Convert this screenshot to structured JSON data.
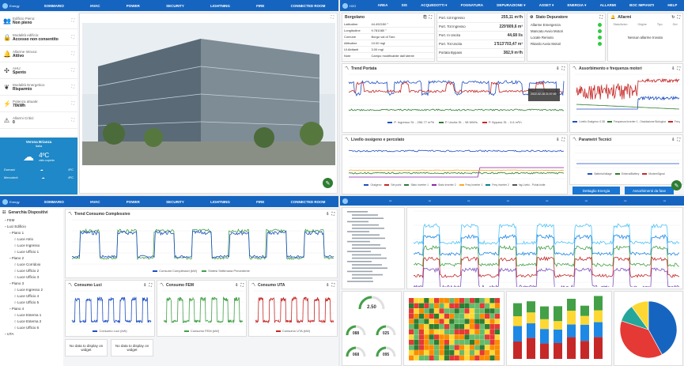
{
  "quad1": {
    "nav": [
      "SOMMARIO",
      "HVAC",
      "POWER",
      "SECURITY",
      "LIGHTNING",
      "FIRE",
      "CONNECTED ROOM"
    ],
    "status": [
      {
        "label": "Edificio Pieno:",
        "value": "Non pieno",
        "icon": "users-icon"
      },
      {
        "label": "Modalità edificio:",
        "value": "Accesso non consentito",
        "icon": "lock-icon"
      },
      {
        "label": "Allarme Intruso:",
        "value": "Attivo",
        "icon": "bell-icon"
      },
      {
        "label": "AHU:",
        "value": "Spento",
        "icon": "fan-icon"
      },
      {
        "label": "Modalità Energetica:",
        "value": "Risparmio",
        "icon": "leaf-icon"
      },
      {
        "label": "Potenza attuale:",
        "value": "70kWh",
        "icon": "bolt-icon"
      },
      {
        "label": "Allarmi Critici:",
        "value": "0",
        "icon": "alarm-icon"
      }
    ],
    "weather": {
      "city": "Verona Brianza",
      "region": "Italia",
      "temp": "4ºC",
      "desc": "cielo coperto",
      "row1_label": "Domani",
      "row2_label": "Mercoledì",
      "row1_temp": "6ºC",
      "row2_temp": "8ºC"
    }
  },
  "quad2": {
    "nav": [
      "AREA",
      "SIS",
      "ACQUEDOTTI ▾",
      "FOGNATURA",
      "DEPURAZIONE ▾",
      "ASSET ▾",
      "ENERGIA ▾",
      "ALLARMI",
      "BOC IMPIANTI",
      "HELP"
    ],
    "site": {
      "name": "Borgolano",
      "rows": [
        [
          "Latitudine",
          "44.492150 °"
        ],
        [
          "Longitudine",
          "9.781080 °"
        ],
        [
          "Comune",
          "Borgo val di Taro"
        ],
        [
          "Altitudine",
          "10.00 mgl"
        ],
        [
          "Ul.Abitanti",
          "3.00 mgl"
        ],
        [
          "Note",
          "Campo modificabile dall'utente"
        ]
      ]
    },
    "ports": [
      [
        "Port. tot Ingresso",
        "255,11 m³/h"
      ],
      [
        "Port. Tot Ingresso",
        "229'809,6 m³"
      ],
      [
        "Port. In Uscita",
        "44,68 l/s"
      ],
      [
        "Port. Tot Uscita",
        "1'513'703,47 m³"
      ],
      [
        "Portata Bypass",
        "382,9 m³/h"
      ]
    ],
    "depuratore": {
      "title": "Stato Depuratore",
      "items": [
        "Allarme Emergenza",
        "Mancato Avvio Motori",
        "Locale Remoto",
        "Ritardo Avvio Motori"
      ]
    },
    "allarmi": {
      "title": "Allarmi",
      "cols": [
        "Stato/Azion",
        "Origine",
        "Tipo",
        "Ord"
      ],
      "empty": "Nessun allarme trovato"
    },
    "trend_portata": {
      "title": "Trend Portata",
      "legend": [
        "P. Ingresso St. - 256.77 m³/h",
        "P. Uscita St. - 98 MW/s",
        "P. Bypass St. - 0.6 m³/h"
      ],
      "tooltip": "2022-02-18 21:07:49"
    },
    "assorbimento": {
      "title": "Assorbimento e frequenza motori",
      "legend": [
        "Livello Ossigeno: 0.38",
        "Frequenza Inverter 1 - Ossidazione Biologica",
        "Freq"
      ]
    },
    "livello": {
      "title": "Livello ossigeno e percolato",
      "legend": [
        "Ossigeno",
        "Set point",
        "Stato Inverter 1",
        "Stato Inverter 2",
        "Freq Inverter 1",
        "Freq Inverter 2",
        "Ing.Livelo - Pohia botte"
      ]
    },
    "tecnici": {
      "title": "Parametri Tecnici",
      "legend": [
        "BatteriaVoltage",
        "ExternalBattery",
        "ModemSignal"
      ]
    },
    "buttons": {
      "b1": "Dettaglio Energia",
      "b2": "Assorbimenti da fase"
    }
  },
  "quad3": {
    "nav": [
      "SOMMARIO",
      "HVAC",
      "POWER",
      "SECURITY",
      "LIGHTNING",
      "FIRE",
      "CONNECTED ROOM"
    ],
    "tree_title": "Gerarchia Dispositivi",
    "tree": [
      "FEM",
      "Luci Edificio",
      "Piano 1",
      "Luce Atrio",
      "Luce Ingresso",
      "Luce Ufficio 1",
      "Piano 2",
      "Luce Corridoio",
      "Luce Ufficio 2",
      "Luce Ufficio 3",
      "Piano 3",
      "Luce Ingresso 2",
      "Luce Ufficio 4",
      "Luce Ufficio 5",
      "Piano 4",
      "Luce Esterna 1",
      "Luce Esterna 2",
      "Luce Ufficio 6",
      "UTA"
    ],
    "trend_title": "Trend Consumo Complessivo",
    "trend_legend": [
      "Consumi Complessivi (kW)",
      "Sintesi Settimana Precedente"
    ],
    "luci_title": "Consumo Luci",
    "luci_legend": "Consumo Luci (kW)",
    "fem_title": "Consumo FEM",
    "fem_legend": "Consumo FEM (kW)",
    "uta_title": "Consumo UTA",
    "uta_legend": "Consumo UTA (kW)",
    "nodata": "No data to display on widget"
  },
  "quad4": {
    "gauges": [
      {
        "v": "2.50"
      },
      {
        "v": "088"
      },
      {
        "v": "025"
      },
      {
        "v": "068"
      },
      {
        "v": "095"
      }
    ]
  },
  "colors": {
    "nav": "#1565c0",
    "blue": "#1976d2",
    "green": "#2e7d32",
    "red": "#d32f2f"
  }
}
